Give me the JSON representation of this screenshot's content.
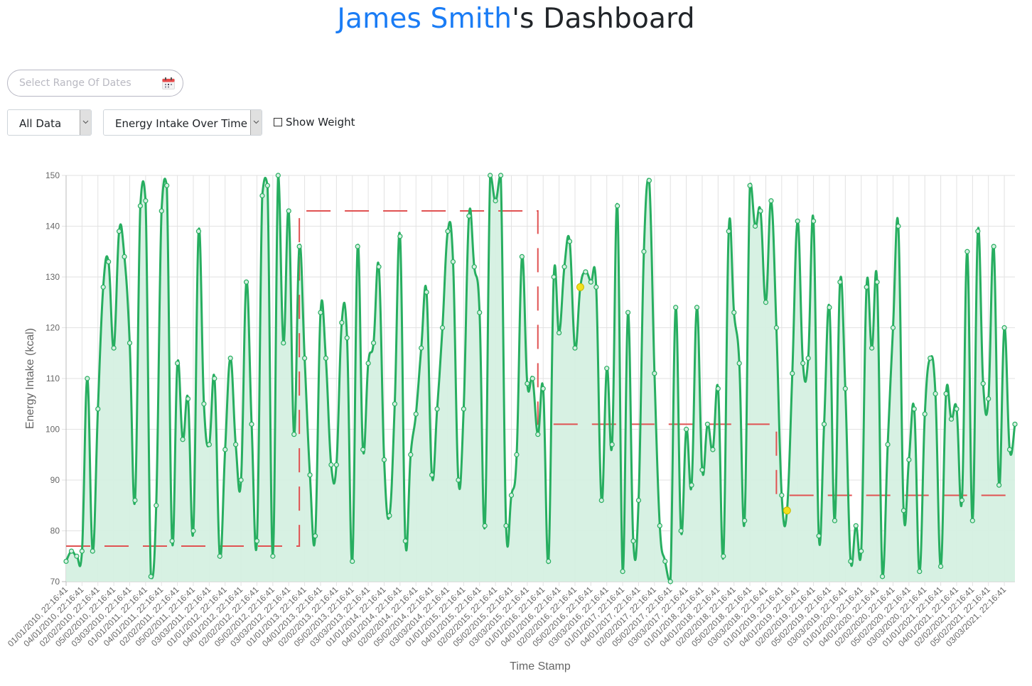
{
  "header": {
    "title_name": "James Smith",
    "title_suffix": "'s Dashboard"
  },
  "controls": {
    "date_range_placeholder": "Select Range Of Dates",
    "calendar_icon": "calendar-icon",
    "data_select_value": "All Data",
    "chart_select_value": "Energy Intake Over Time",
    "show_weight_label": "Show Weight",
    "show_weight_checked": false
  },
  "colors": {
    "accent": "#1a7cf5",
    "line": "#27ae60",
    "fill": "#d5f0e1",
    "weight_line": "#e05252",
    "highlight": "#f2e01d"
  },
  "chart_data": {
    "type": "line",
    "title": "",
    "xlabel": "Time Stamp",
    "ylabel": "Energy Intake (kcal)",
    "ylim": [
      70,
      150
    ],
    "yticks": [
      70,
      80,
      90,
      100,
      110,
      120,
      130,
      140,
      150
    ],
    "grid": true,
    "x_tick_labels": [
      "01/01/2010, 22:16:41",
      "04/01/2010, 22:16:41",
      "02/02/2010, 22:16:41",
      "05/02/2010, 22:16:41",
      "03/03/2010, 22:16:41",
      "01/01/2011, 22:16:41",
      "04/01/2011, 22:16:41",
      "02/02/2011, 22:16:41",
      "05/02/2011, 22:16:41",
      "03/03/2011, 22:16:41",
      "01/01/2012, 22:16:41",
      "04/01/2012, 22:16:41",
      "02/02/2012, 22:16:41",
      "05/02/2012, 22:16:41",
      "03/03/2012, 22:16:41",
      "01/01/2013, 22:16:41",
      "04/01/2013, 22:16:41",
      "02/02/2013, 22:16:41",
      "05/02/2013, 22:16:41",
      "03/03/2013, 22:16:41",
      "01/01/2014, 22:16:41",
      "04/01/2014, 22:16:41",
      "02/02/2014, 22:16:41",
      "05/02/2014, 22:16:41",
      "03/03/2014, 22:16:41",
      "01/01/2015, 22:16:41",
      "04/01/2015, 22:16:41",
      "02/02/2015, 22:16:41",
      "05/02/2015, 22:16:41",
      "03/03/2015, 22:16:41",
      "01/01/2016, 22:16:41",
      "04/01/2016, 22:16:41",
      "02/02/2016, 22:16:41",
      "05/02/2016, 22:16:41",
      "03/03/2016, 22:16:41",
      "01/01/2017, 22:16:41",
      "04/01/2017, 22:16:41",
      "02/02/2017, 22:16:41",
      "05/02/2017, 22:16:41",
      "03/03/2017, 22:16:41",
      "01/01/2018, 22:16:41",
      "04/01/2018, 22:16:41",
      "02/02/2018, 22:16:41",
      "05/02/2018, 22:16:41",
      "03/03/2018, 22:16:41",
      "01/01/2019, 22:16:41",
      "04/01/2019, 22:16:41",
      "02/02/2019, 22:16:41",
      "05/02/2019, 22:16:41",
      "03/03/2019, 22:16:41",
      "01/01/2020, 22:16:41",
      "04/01/2020, 22:16:41",
      "02/02/2020, 22:16:41",
      "05/02/2020, 22:16:41",
      "03/03/2020, 22:16:41",
      "01/01/2021, 22:16:41",
      "04/01/2021, 22:16:41",
      "02/02/2021, 22:16:41",
      "05/02/2021, 22:16:41",
      "03/03/2021, 22:16:41"
    ],
    "points_per_tick": 3,
    "series": [
      {
        "name": "Energy Intake",
        "type": "area-line",
        "values": [
          74,
          76,
          75,
          76,
          110,
          76,
          104,
          128,
          133,
          116,
          139,
          134,
          117,
          86,
          144,
          145,
          71,
          85,
          143,
          148,
          78,
          113,
          98,
          106,
          80,
          139,
          105,
          97,
          110,
          75,
          96,
          114,
          97,
          90,
          129,
          101,
          78,
          146,
          148,
          75,
          150,
          117,
          143,
          99,
          136,
          114,
          91,
          79,
          123,
          114,
          93,
          93,
          121,
          118,
          74,
          136,
          96,
          113,
          117,
          132,
          94,
          83,
          105,
          138,
          78,
          95,
          103,
          116,
          127,
          91,
          104,
          120,
          139,
          133,
          90,
          104,
          142,
          132,
          123,
          81,
          150,
          145,
          150,
          81,
          87,
          95,
          134,
          109,
          110,
          99,
          108,
          74,
          130,
          119,
          132,
          137,
          116,
          128,
          131,
          129,
          128,
          86,
          112,
          97,
          144,
          72,
          123,
          78,
          86,
          135,
          149,
          111,
          81,
          74,
          70,
          124,
          80,
          100,
          89,
          124,
          92,
          101,
          96,
          108,
          75,
          139,
          123,
          113,
          82,
          148,
          140,
          143,
          125,
          145,
          120,
          87,
          84,
          111,
          141,
          113,
          114,
          141,
          79,
          101,
          124,
          82,
          129,
          108,
          74,
          81,
          76,
          128,
          116,
          129,
          71,
          97,
          120,
          140,
          84,
          94,
          104,
          72,
          103,
          114,
          107,
          73,
          107,
          102,
          104,
          86,
          135,
          82,
          139,
          109,
          106,
          136,
          89,
          120,
          96,
          101
        ]
      },
      {
        "name": "Weight (avg)",
        "type": "step-dashed",
        "segments": [
          {
            "from_index": 0,
            "to_index": 44,
            "value": 77
          },
          {
            "from_index": 44,
            "to_index": 89,
            "value": 143
          },
          {
            "from_index": 89,
            "to_index": 134,
            "value": 101
          },
          {
            "from_index": 134,
            "to_index": 179,
            "value": 87
          }
        ]
      }
    ],
    "highlighted_points": [
      {
        "index": 97,
        "value": 128
      },
      {
        "index": 136,
        "value": 84
      }
    ]
  }
}
